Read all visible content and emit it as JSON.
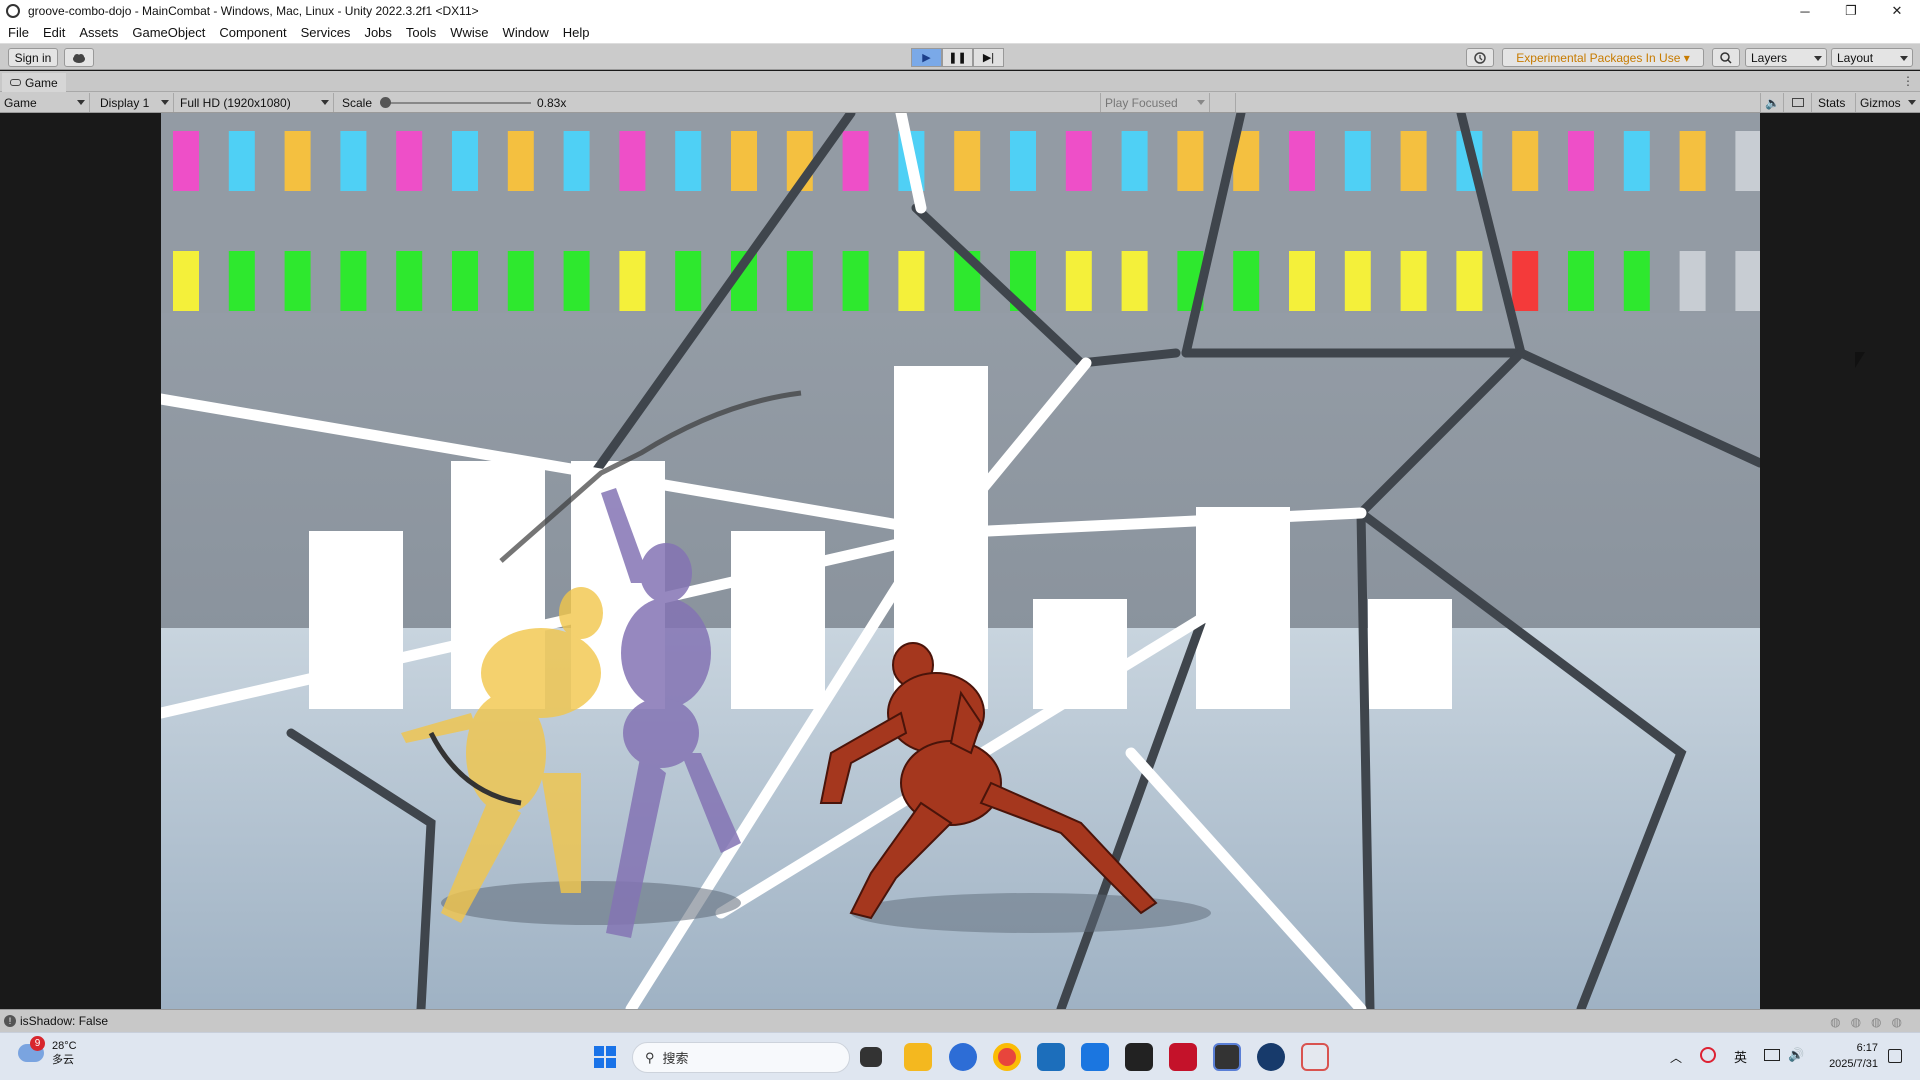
{
  "window": {
    "title": "groove-combo-dojo - MainCombat - Windows, Mac, Linux - Unity 2022.3.2f1 <DX11>",
    "minimize": "─",
    "restore": "❐",
    "close": "✕"
  },
  "menu": [
    "File",
    "Edit",
    "Assets",
    "GameObject",
    "Component",
    "Services",
    "Jobs",
    "Tools",
    "Wwise",
    "Window",
    "Help"
  ],
  "toolbar": {
    "sign_in": "Sign in",
    "cloud_icon": "cloud-icon",
    "play_icon": "▶",
    "pause_icon": "❚❚",
    "step_icon": "▶|",
    "history_icon": "history-icon",
    "experimental": "Experimental Packages In Use ▾",
    "search_icon": "search-icon",
    "layers": "Layers",
    "layout": "Layout",
    "accent_play": "#7aa9e8",
    "warning_color": "#c77b00"
  },
  "tab": {
    "label": "Game"
  },
  "gamebar": {
    "view": "Game",
    "display": "Display 1",
    "resolution": "Full HD (1920x1080)",
    "scale_label": "Scale",
    "scale_value": "0.83x",
    "scale_level": 0.0,
    "play_focused": "Play Focused",
    "stats": "Stats",
    "gizmos": "Gizmos"
  },
  "status": {
    "message": "isShadow: False"
  },
  "taskbar": {
    "weather_badge": "9",
    "temperature": "28°C",
    "condition": "多云",
    "search_placeholder": "搜索",
    "ime": "英",
    "time": "6:17",
    "date": "2025/7/31"
  },
  "scene": {
    "top_row_colors": [
      "#ee4fc8",
      "#4fd0f5",
      "#f4c040",
      "#4fd0f5",
      "#ee4fc8",
      "#4fd0f5",
      "#f4c040",
      "#4fd0f5",
      "#ee4fc8",
      "#4fd0f5",
      "#f4c040",
      "#f4c040",
      "#ee4fc8",
      "#4fd0f5",
      "#f4c040",
      "#4fd0f5",
      "#ee4fc8",
      "#4fd0f5",
      "#f4c040",
      "#f4c040",
      "#ee4fc8",
      "#4fd0f5",
      "#f4c040",
      "#4fd0f5",
      "#f4c040",
      "#ee4fc8",
      "#4fd0f5",
      "#f4c040",
      "#c8cdd3",
      "#c8cdd3",
      "#c8cdd3",
      "#c8cdd3"
    ],
    "bottom_row_colors": [
      "#f4f03a",
      "#2ee82e",
      "#2ee82e",
      "#2ee82e",
      "#2ee82e",
      "#2ee82e",
      "#2ee82e",
      "#2ee82e",
      "#f4f03a",
      "#2ee82e",
      "#2ee82e",
      "#2ee82e",
      "#2ee82e",
      "#f4f03a",
      "#2ee82e",
      "#2ee82e",
      "#f4f03a",
      "#f4f03a",
      "#2ee82e",
      "#2ee82e",
      "#f4f03a",
      "#f4f03a",
      "#f4f03a",
      "#f4f03a",
      "#f43a3a",
      "#2ee82e",
      "#2ee82e",
      "#c8cdd3",
      "#c8cdd3",
      "#c8cdd3",
      "#c8cdd3",
      "#c8cdd3"
    ]
  }
}
